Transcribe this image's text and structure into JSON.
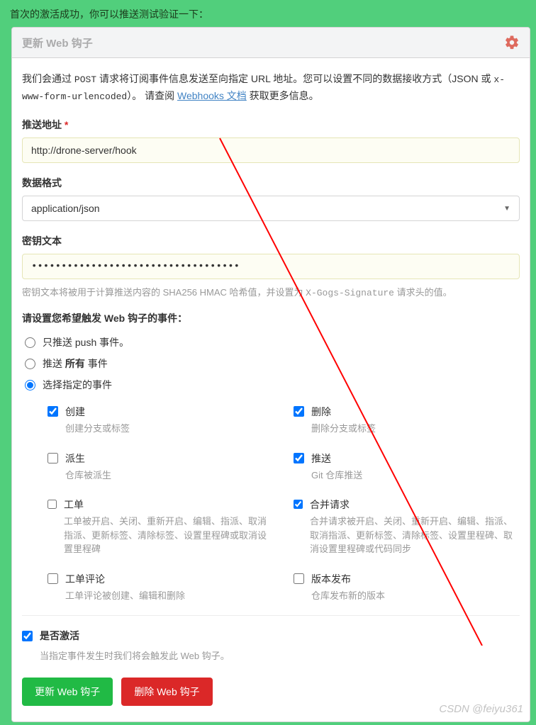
{
  "banner": "首次的激活成功，你可以推送测试验证一下：",
  "panel": {
    "title": "更新 Web 钩子"
  },
  "intro": {
    "p1_a": "我们会通过 ",
    "p1_b": " 请求将订阅事件信息发送至向指定 URL 地址。您可以设置不同的数据接收方式（JSON 或 ",
    "code_post": "POST",
    "code_enc": "x-www-form-urlencoded",
    "p1_c": "）。 请查阅 ",
    "link": "Webhooks 文档",
    "p1_d": " 获取更多信息。"
  },
  "fields": {
    "url_label": "推送地址",
    "url_value": "http://drone-server/hook",
    "format_label": "数据格式",
    "format_value": "application/json",
    "secret_label": "密钥文本",
    "secret_value": "•••••••••••••••••••••••••••••••••••",
    "secret_hint_a": "密钥文本将被用于计算推送内容的 SHA256 HMAC 哈希值，并设置为 ",
    "secret_hint_code": "X-Gogs-Signature",
    "secret_hint_b": " 请求头的值。"
  },
  "events": {
    "title": "请设置您希望触发 Web 钩子的事件：",
    "radios": {
      "push_only": "只推送 push 事件。",
      "all_a": "推送 ",
      "all_b": " 事件",
      "all_bold": "所有",
      "select": "选择指定的事件"
    },
    "items": [
      {
        "key": "create",
        "title": "创建",
        "desc": "创建分支或标签",
        "checked": true
      },
      {
        "key": "delete",
        "title": "删除",
        "desc": "删除分支或标签",
        "checked": true
      },
      {
        "key": "fork",
        "title": "派生",
        "desc": "仓库被派生",
        "checked": false
      },
      {
        "key": "push",
        "title": "推送",
        "desc": "Git 仓库推送",
        "checked": true
      },
      {
        "key": "issues",
        "title": "工单",
        "desc": "工单被开启、关闭、重新开启、编辑、指派、取消指派、更新标签、清除标签、设置里程碑或取消设置里程碑",
        "checked": false
      },
      {
        "key": "pull_request",
        "title": "合并请求",
        "desc": "合并请求被开启、关闭、重新开启、编辑、指派、取消指派、更新标签、清除标签、设置里程碑、取消设置里程碑或代码同步",
        "checked": true
      },
      {
        "key": "issue_comment",
        "title": "工单评论",
        "desc": "工单评论被创建、编辑和删除",
        "checked": false
      },
      {
        "key": "release",
        "title": "版本发布",
        "desc": "仓库发布新的版本",
        "checked": false
      }
    ]
  },
  "active": {
    "label": "是否激活",
    "hint": "当指定事件发生时我们将会触发此 Web 钩子。",
    "checked": true
  },
  "buttons": {
    "update": "更新 Web 钩子",
    "delete": "删除 Web 钩子"
  },
  "watermark": "CSDN @feiyu361"
}
